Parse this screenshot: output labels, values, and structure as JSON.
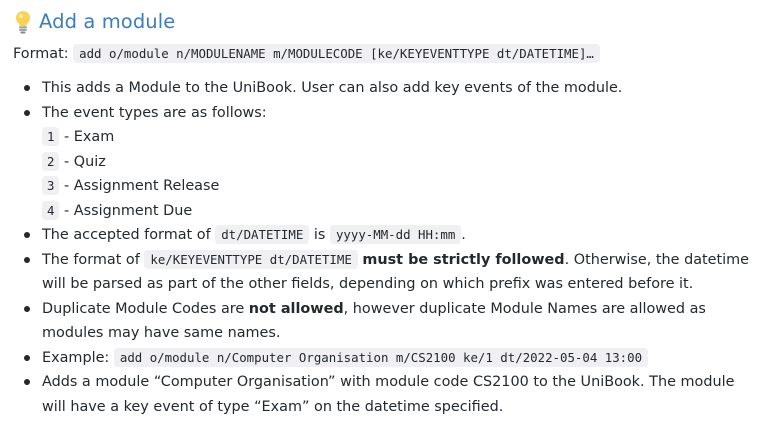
{
  "heading": {
    "icon": "lightbulb-icon",
    "title": "Add a module"
  },
  "format": {
    "label": "Format:",
    "code": "add o/module n/MODULENAME m/MODULECODE [ke/KEYEVENTTYPE dt/DATETIME]…"
  },
  "bullets": {
    "b1": "This adds a Module to the UniBook. User can also add key events of the module.",
    "b2": "The event types are as follows:",
    "event_types": [
      {
        "code": "1",
        "label": " - Exam"
      },
      {
        "code": "2",
        "label": " - Quiz"
      },
      {
        "code": "3",
        "label": " - Assignment Release"
      },
      {
        "code": "4",
        "label": " - Assignment Due"
      }
    ],
    "b3": {
      "pre": "The accepted format of ",
      "code1": "dt/DATETIME",
      "mid": " is ",
      "code2": "yyyy-MM-dd HH:mm",
      "post": "."
    },
    "b4": {
      "pre": "The format of ",
      "code": "ke/KEYEVENTTYPE dt/DATETIME",
      "bold": "must be strictly followed",
      "post": ". Otherwise, the datetime will be parsed as part of the other fields, depending on which prefix was entered before it."
    },
    "b5": {
      "pre": "Duplicate Module Codes are ",
      "bold": "not allowed",
      "post": ", however duplicate Module Names are allowed as modules may have same names."
    },
    "b6": {
      "pre": "Example: ",
      "code": "add o/module n/Computer Organisation m/CS2100 ke/1 dt/2022-05-04 13:00"
    },
    "b7": "Adds a module “Computer Organisation” with module code CS2100 to the UniBook. The module will have a key event of type “Exam” on the datetime specified."
  },
  "colors": {
    "heading": "#3d7db8",
    "code_background": "#f0f0f3",
    "text": "#24292e"
  }
}
